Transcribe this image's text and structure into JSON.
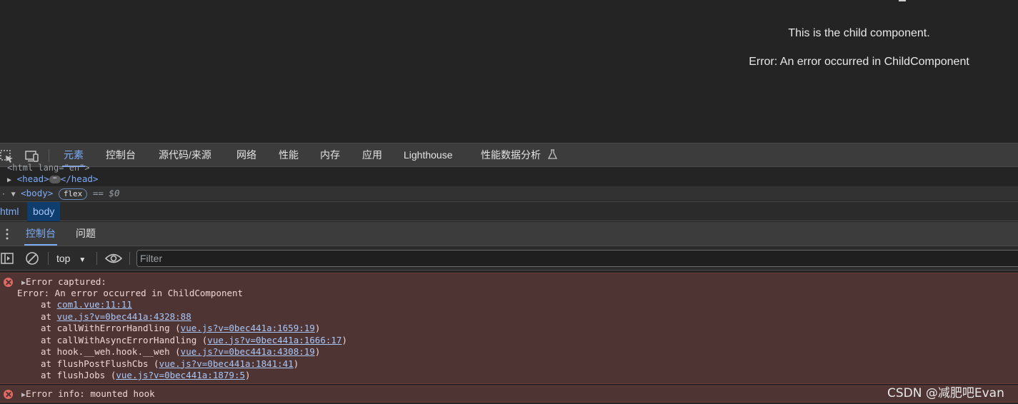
{
  "viewport": {
    "line1": "This is the child component.",
    "line2": "Error: An error occurred in ChildComponent"
  },
  "devtools": {
    "icons": [
      "inspect-element-icon",
      "device-toolbar-icon"
    ],
    "tabs": [
      "元素",
      "控制台",
      "源代码/来源",
      "网络",
      "性能",
      "内存",
      "应用",
      "Lighthouse",
      "性能数据分析"
    ],
    "active_tab": "元素"
  },
  "elements": {
    "clipped_line": "<html lang=\"en\">",
    "head_open": "<head>",
    "head_ellipsis": "⋯",
    "head_close": "</head>",
    "body_open": "<body>",
    "body_badge": "flex",
    "selected_ref": "== $0"
  },
  "breadcrumb": {
    "items": [
      "html",
      "body"
    ]
  },
  "drawer": {
    "tabs": [
      "控制台",
      "问题"
    ]
  },
  "toolbar": {
    "context": "top",
    "filter_placeholder": "Filter"
  },
  "console": {
    "messages": [
      {
        "summary": "Error captured:",
        "detail": "Error: An error occurred in ChildComponent",
        "stack": [
          {
            "prefix": "at ",
            "fn": "",
            "link": "com1.vue:11:11"
          },
          {
            "prefix": "at ",
            "fn": "",
            "link": "vue.js?v=0bec441a:4328:88"
          },
          {
            "prefix": "at ",
            "fn": "callWithErrorHandling (",
            "link": "vue.js?v=0bec441a:1659:19",
            "suffix": ")"
          },
          {
            "prefix": "at ",
            "fn": "callWithAsyncErrorHandling (",
            "link": "vue.js?v=0bec441a:1666:17",
            "suffix": ")"
          },
          {
            "prefix": "at ",
            "fn": "hook.__weh.hook.__weh (",
            "link": "vue.js?v=0bec441a:4308:19",
            "suffix": ")"
          },
          {
            "prefix": "at ",
            "fn": "flushPostFlushCbs (",
            "link": "vue.js?v=0bec441a:1841:41",
            "suffix": ")"
          },
          {
            "prefix": "at ",
            "fn": "flushJobs (",
            "link": "vue.js?v=0bec441a:1879:5",
            "suffix": ")"
          }
        ]
      },
      {
        "summary": "Error info: mounted hook"
      }
    ]
  },
  "watermark": "CSDN @减肥吧Evan",
  "colors": {
    "accent": "#7cacf8",
    "error_bg": "#4e3534",
    "error_icon": "#e46962"
  }
}
